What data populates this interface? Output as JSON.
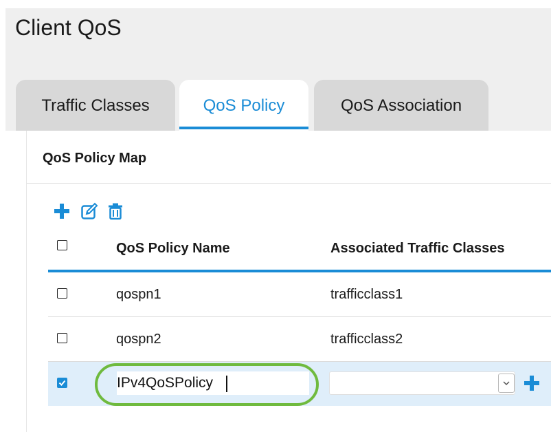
{
  "page": {
    "title": "Client QoS"
  },
  "tabs": [
    {
      "label": "Traffic Classes",
      "active": false
    },
    {
      "label": "QoS Policy",
      "active": true
    },
    {
      "label": "QoS Association",
      "active": false
    }
  ],
  "panel": {
    "title": "QoS Policy Map",
    "toolbar": {
      "add_icon": "plus-icon",
      "edit_icon": "edit-icon",
      "delete_icon": "trash-icon"
    }
  },
  "table": {
    "columns": [
      "QoS Policy Name",
      "Associated Traffic Classes"
    ],
    "rows": [
      {
        "checked": false,
        "policy_name": "qospn1",
        "traffic_classes": "trafficclass1"
      },
      {
        "checked": false,
        "policy_name": "qospn2",
        "traffic_classes": "trafficclass2"
      }
    ],
    "new_row": {
      "checked": true,
      "policy_name_value": "IPv4QoSPolicy",
      "traffic_class_selected": "",
      "add_icon": "plus-icon"
    }
  },
  "colors": {
    "accent": "#1a8cd6",
    "highlight": "#6fba3e",
    "selected_row": "#dfeefa"
  }
}
